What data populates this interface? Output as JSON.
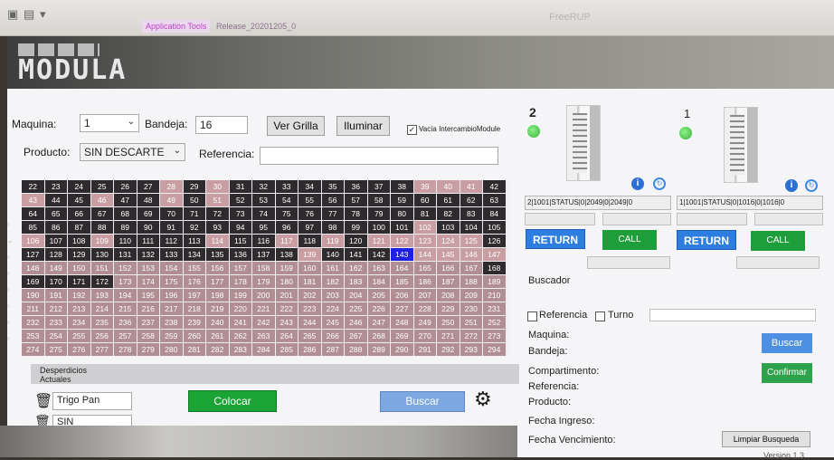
{
  "titlebar": {
    "app_tools": "Application Tools",
    "release": "Release_20201205_0",
    "right_title": "FreeRUP"
  },
  "logo": "MODULA",
  "form": {
    "maquina_label": "Maquina:",
    "maquina_value": "1",
    "bandeja_label": "Bandeja:",
    "bandeja_value": "16",
    "ver_grilla": "Ver Grilla",
    "iluminar": "Iluminar",
    "vacia_label": "Vacía IntercambioModule",
    "producto_label": "Producto:",
    "producto_value": "SIN DESCARTE",
    "referencia_label": "Referencia:"
  },
  "grid": {
    "cells": [
      [
        "22",
        "23",
        "24",
        "25",
        "26",
        "27",
        "28",
        "29",
        "30",
        "31",
        "32",
        "33",
        "34",
        "35",
        "36",
        "37",
        "38",
        "39",
        "40",
        "41",
        "42"
      ],
      [
        "43",
        "44",
        "45",
        "46",
        "47",
        "48",
        "49",
        "50",
        "51",
        "52",
        "53",
        "54",
        "55",
        "56",
        "57",
        "58",
        "59",
        "60",
        "61",
        "62",
        "63"
      ],
      [
        "64",
        "65",
        "66",
        "67",
        "68",
        "69",
        "70",
        "71",
        "72",
        "73",
        "74",
        "75",
        "76",
        "77",
        "78",
        "79",
        "80",
        "81",
        "82",
        "83",
        "84"
      ],
      [
        "85",
        "86",
        "87",
        "88",
        "89",
        "90",
        "91",
        "92",
        "93",
        "94",
        "95",
        "96",
        "97",
        "98",
        "99",
        "100",
        "101",
        "102",
        "103",
        "104",
        "105"
      ],
      [
        "106",
        "107",
        "108",
        "109",
        "110",
        "111",
        "112",
        "113",
        "114",
        "115",
        "116",
        "117",
        "118",
        "119",
        "120",
        "121",
        "122",
        "123",
        "124",
        "125",
        "126"
      ],
      [
        "127",
        "128",
        "129",
        "130",
        "131",
        "132",
        "133",
        "134",
        "135",
        "136",
        "137",
        "138",
        "139",
        "140",
        "141",
        "142",
        "143",
        "144",
        "145",
        "146",
        "147"
      ],
      [
        "148",
        "149",
        "150",
        "151",
        "152",
        "153",
        "154",
        "155",
        "156",
        "157",
        "158",
        "159",
        "160",
        "161",
        "162",
        "163",
        "164",
        "165",
        "166",
        "167",
        "168"
      ],
      [
        "169",
        "170",
        "171",
        "172",
        "173",
        "174",
        "175",
        "176",
        "177",
        "178",
        "179",
        "180",
        "181",
        "182",
        "183",
        "184",
        "185",
        "186",
        "187",
        "188",
        "189"
      ],
      [
        "190",
        "191",
        "192",
        "193",
        "194",
        "195",
        "196",
        "197",
        "198",
        "199",
        "200",
        "201",
        "202",
        "203",
        "204",
        "205",
        "206",
        "207",
        "208",
        "209",
        "210"
      ],
      [
        "211",
        "212",
        "213",
        "214",
        "215",
        "216",
        "217",
        "218",
        "219",
        "220",
        "221",
        "222",
        "223",
        "224",
        "225",
        "226",
        "227",
        "228",
        "229",
        "230",
        "231"
      ],
      [
        "232",
        "233",
        "234",
        "235",
        "236",
        "237",
        "238",
        "239",
        "240",
        "241",
        "242",
        "243",
        "244",
        "245",
        "246",
        "247",
        "248",
        "249",
        "250",
        "251",
        "252"
      ],
      [
        "253",
        "254",
        "255",
        "256",
        "257",
        "258",
        "259",
        "260",
        "261",
        "262",
        "263",
        "264",
        "265",
        "266",
        "267",
        "268",
        "269",
        "270",
        "271",
        "272",
        "273"
      ],
      [
        "274",
        "275",
        "276",
        "277",
        "278",
        "279",
        "280",
        "281",
        "282",
        "283",
        "284",
        "285",
        "286",
        "287",
        "288",
        "289",
        "290",
        "291",
        "292",
        "293",
        "294"
      ]
    ],
    "selected": "143"
  },
  "desperdicios": {
    "title_line1": "Desperdicios",
    "title_line2": "Actuales",
    "item1": "Trigo Pan",
    "item2": "SIN DESCARTE",
    "colocar": "Colocar",
    "buscar": "Buscar"
  },
  "machines": [
    {
      "number": "2",
      "status": "2|1001|STATUS|0|2049|0|2049|0",
      "return_label": "RETURN",
      "call_label": "CALL"
    },
    {
      "number": "1",
      "status": "1|1001|STATUS|0|1016|0|1016|0",
      "return_label": "RETURN",
      "call_label": "CALL"
    }
  ],
  "buscador": {
    "title": "Buscador",
    "referencia": "Referencia",
    "turno": "Turno",
    "maquina": "Maquina:",
    "bandeja": "Bandeja:",
    "compartimento": "Compartimento:",
    "referencia_field": "Referencia:",
    "producto": "Producto:",
    "fecha_ingreso": "Fecha Ingreso:",
    "fecha_vencimiento": "Fecha Vencimiento:",
    "buscar_btn": "Buscar",
    "confirmar_btn": "Confirmar",
    "limpiar_btn": "Limpiar Busqueda",
    "version": "Version 1.3"
  }
}
